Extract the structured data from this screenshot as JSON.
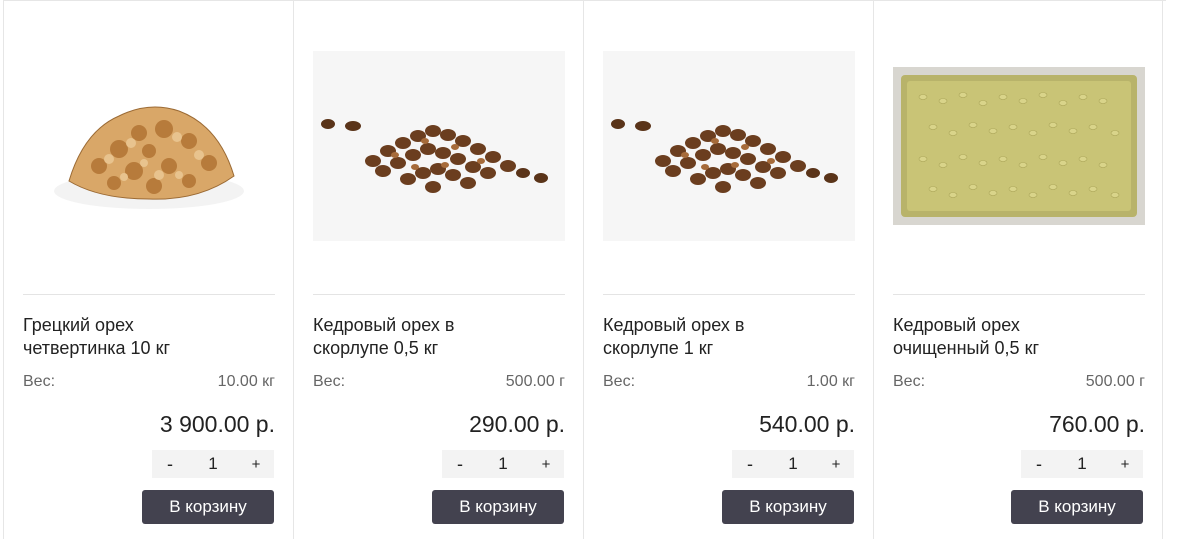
{
  "products": [
    {
      "title_line1": "Грецкий орех",
      "title_line2": "четвертинка 10 кг",
      "weight_label": "Вес:",
      "weight_value": "10.00 кг",
      "price": "3 900.00 р.",
      "qty_minus": "-",
      "qty_value": "1",
      "qty_plus": "+",
      "cart_label": "В корзину",
      "image_icon": "walnut-photo"
    },
    {
      "title_line1": "Кедровый орех в",
      "title_line2": "скорлупе 0,5 кг",
      "weight_label": "Вес:",
      "weight_value": "500.00 г",
      "price": "290.00 р.",
      "qty_minus": "-",
      "qty_value": "1",
      "qty_plus": "+",
      "cart_label": "В корзину",
      "image_icon": "pine-nuts-in-shell-photo"
    },
    {
      "title_line1": "Кедровый орех в",
      "title_line2": "скорлупе 1 кг",
      "weight_label": "Вес:",
      "weight_value": "1.00 кг",
      "price": "540.00 р.",
      "qty_minus": "-",
      "qty_value": "1",
      "qty_plus": "+",
      "cart_label": "В корзину",
      "image_icon": "pine-nuts-in-shell-photo"
    },
    {
      "title_line1": "Кедровый орех",
      "title_line2": "очищенный 0,5 кг",
      "weight_label": "Вес:",
      "weight_value": "500.00 г",
      "price": "760.00 р.",
      "qty_minus": "-",
      "qty_value": "1",
      "qty_plus": "+",
      "cart_label": "В корзину",
      "image_icon": "shelled-pine-nuts-bag-photo"
    }
  ],
  "colors": {
    "button_bg": "#43424f",
    "qty_bg": "#f3f3f3",
    "divider": "#e4e4e4"
  }
}
